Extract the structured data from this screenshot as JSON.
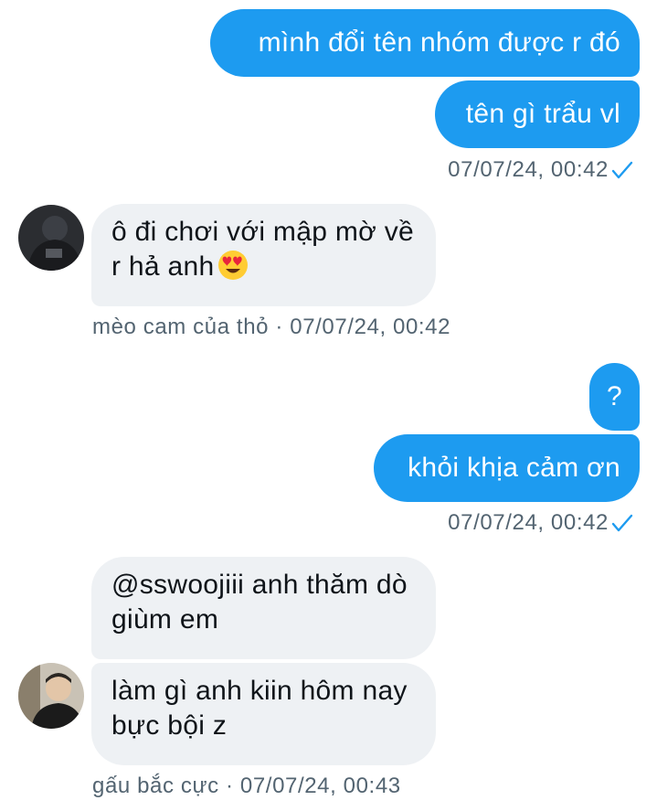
{
  "conversation": {
    "group1": {
      "messages": [
        "mình đổi tên nhóm được r đó",
        "tên gì trẩu vl"
      ],
      "timestamp": "07/07/24, 00:42"
    },
    "group2": {
      "message": "ô đi chơi với mập mờ về r hả anh",
      "emoji": "heart-eyes-emoji",
      "sender": "mèo cam của thỏ",
      "separator": "·",
      "timestamp": "07/07/24, 00:42"
    },
    "group3": {
      "messages": [
        "?",
        "khỏi khịa cảm ơn"
      ],
      "timestamp": "07/07/24, 00:42"
    },
    "group4": {
      "messages": [
        "@sswoojiii anh thăm dò giùm em",
        "làm gì anh kiin hôm nay bực bội z"
      ],
      "sender": "gấu bắc cực",
      "separator": "·",
      "timestamp": "07/07/24, 00:43"
    }
  },
  "colors": {
    "outgoing_bubble": "#1d9bf0",
    "incoming_bubble": "#eef1f4",
    "meta_text": "#536471",
    "read_check": "#1d9bf0"
  },
  "icons": {
    "read_receipt": "checkmark-icon"
  }
}
